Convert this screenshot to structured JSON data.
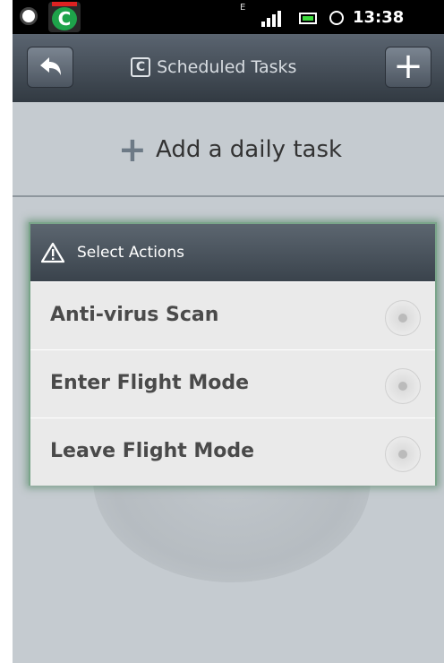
{
  "status_bar": {
    "time": "13:38",
    "network_label": "E"
  },
  "header": {
    "title_logo": "C",
    "title": "Scheduled Tasks",
    "back_icon": "back-arrow-icon",
    "add_icon": "plus-icon"
  },
  "add_task": {
    "label": "Add a daily task"
  },
  "dialog": {
    "title": "Select Actions",
    "options": [
      {
        "label": "Anti-virus Scan"
      },
      {
        "label": "Enter Flight Mode"
      },
      {
        "label": "Leave Flight Mode"
      }
    ]
  },
  "colors": {
    "title_bar": "#3a434c",
    "background": "#c5cbd0",
    "dialog_glow": "#7aa58a"
  }
}
